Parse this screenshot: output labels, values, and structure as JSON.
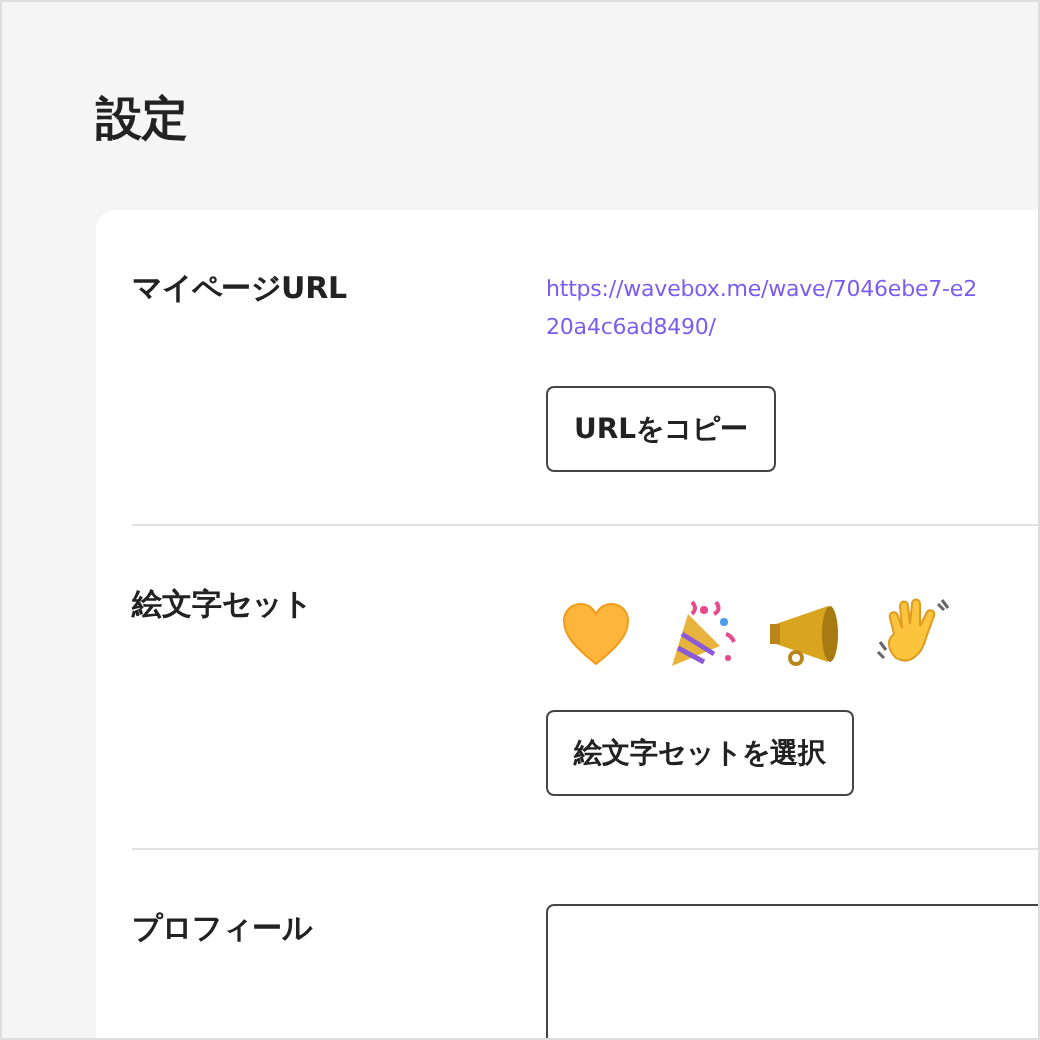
{
  "page_title": "設定",
  "rows": [
    {
      "kind": "url",
      "label": "マイページURL",
      "url_lines": [
        "https://wavebox.me/wave/7046ebe7-e2",
        "20a4c6ad8490/"
      ],
      "button": "URLをコピー"
    },
    {
      "kind": "emoji",
      "label": "絵文字セット",
      "button": "絵文字セットを選択"
    },
    {
      "kind": "textarea",
      "label": "プロフィール"
    }
  ]
}
